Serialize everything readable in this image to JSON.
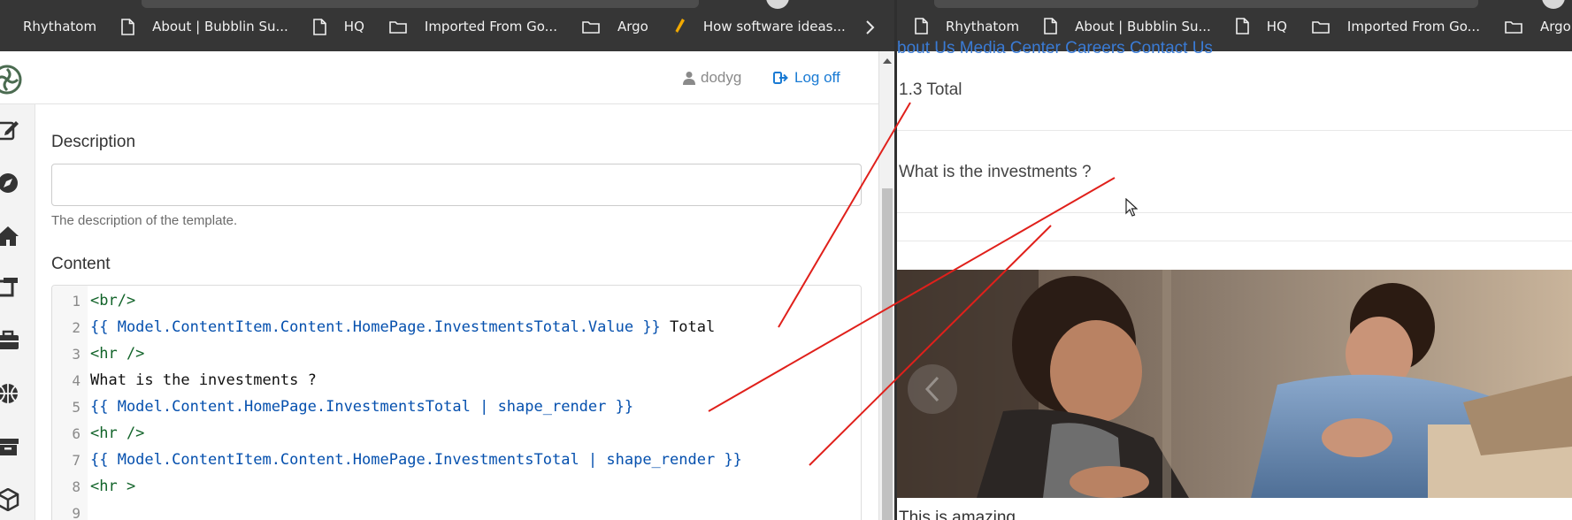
{
  "bookmarks_left": [
    {
      "label": "Rhythatom",
      "icon": "none"
    },
    {
      "label": "About | Bubblin Su...",
      "icon": "page-icon"
    },
    {
      "label": "HQ",
      "icon": "page-icon"
    },
    {
      "label": "Imported From Go...",
      "icon": "folder-icon"
    },
    {
      "label": "Argo",
      "icon": "folder-icon"
    },
    {
      "label": "How software ideas...",
      "icon": "pencil-icon"
    }
  ],
  "bookmarks_right": [
    {
      "label": "Rhythatom",
      "icon": "page-icon"
    },
    {
      "label": "About | Bubblin Su...",
      "icon": "page-icon"
    },
    {
      "label": "HQ",
      "icon": "page-icon"
    },
    {
      "label": "Imported From Go...",
      "icon": "folder-icon"
    },
    {
      "label": "Argo",
      "icon": "folder-icon"
    }
  ],
  "header": {
    "username": "dodyg",
    "logoff_label": "Log off"
  },
  "form": {
    "description_label": "Description",
    "description_value": "",
    "description_hint": "The description of the template.",
    "content_label": "Content"
  },
  "editor": {
    "lines": [
      {
        "n": "1",
        "parts": [
          {
            "t": "tag",
            "s": "<br/>"
          }
        ]
      },
      {
        "n": "2",
        "parts": [
          {
            "t": "mustache",
            "s": "{{ Model.ContentItem.Content.HomePage.InvestmentsTotal.Value }}"
          },
          {
            "t": "txt",
            "s": " Total"
          }
        ]
      },
      {
        "n": "3",
        "parts": [
          {
            "t": "tag",
            "s": "<hr />"
          }
        ]
      },
      {
        "n": "4",
        "parts": [
          {
            "t": "txt",
            "s": "What is the investments ?"
          }
        ]
      },
      {
        "n": "5",
        "parts": [
          {
            "t": "mustache",
            "s": "{{ Model.Content.HomePage.InvestmentsTotal | shape_render }}"
          }
        ]
      },
      {
        "n": "6",
        "parts": [
          {
            "t": "tag",
            "s": "<hr />"
          }
        ]
      },
      {
        "n": "7",
        "parts": [
          {
            "t": "mustache",
            "s": "{{ Model.ContentItem.Content.HomePage.InvestmentsTotal | shape_render }}"
          }
        ]
      },
      {
        "n": "8",
        "parts": [
          {
            "t": "tag",
            "s": "<hr >"
          }
        ]
      },
      {
        "n": "9",
        "parts": []
      }
    ]
  },
  "preview": {
    "top_links": "bout Us Media Center Careers Contact Us",
    "total_text": "1.3 Total",
    "question_text": "What is the investments ?",
    "caption_text": "This is amazing"
  },
  "colors": {
    "bookmarks_bg": "#363636",
    "link_blue": "#1a7bd4",
    "annotation_red": "#e0201b",
    "tag_green": "#116329",
    "mustache_blue": "#0550ae"
  }
}
